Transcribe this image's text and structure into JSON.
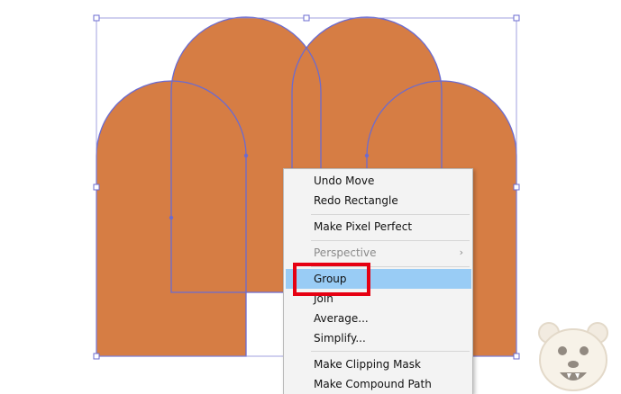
{
  "context_menu": {
    "items": [
      {
        "label": "Undo Move",
        "state": "enabled"
      },
      {
        "label": "Redo Rectangle",
        "state": "enabled"
      },
      {
        "label": "Make Pixel Perfect",
        "state": "enabled"
      },
      {
        "label": "Perspective",
        "state": "disabled",
        "has_submenu": true,
        "submenu_arrow": "›"
      },
      {
        "label": "Group",
        "state": "highlighted"
      },
      {
        "label": "Join",
        "state": "enabled"
      },
      {
        "label": "Average...",
        "state": "enabled"
      },
      {
        "label": "Simplify...",
        "state": "enabled"
      },
      {
        "label": "Make Clipping Mask",
        "state": "enabled"
      },
      {
        "label": "Make Compound Path",
        "state": "enabled"
      }
    ]
  },
  "colors": {
    "shape_fill": "#d67d44",
    "selection_stroke": "#6b6bd0",
    "menu_highlight": "#99ccf5",
    "annotation_box": "#e60012"
  },
  "icons": {
    "mascot": "bear-mascot-icon",
    "submenu": "chevron-right-icon"
  }
}
